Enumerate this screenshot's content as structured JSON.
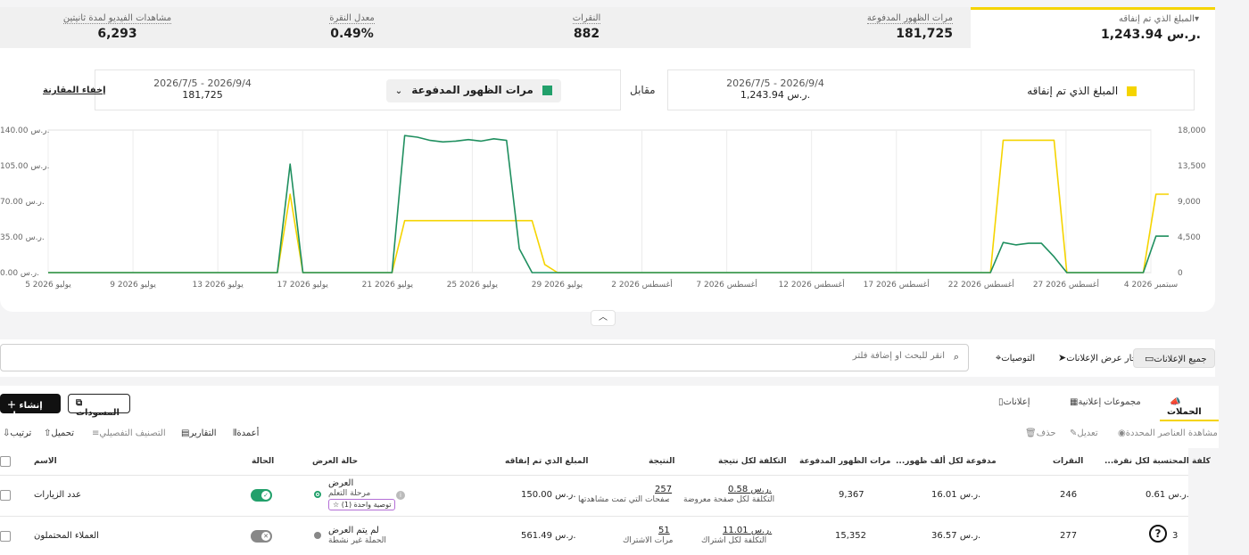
{
  "metrics": [
    {
      "label": "المبلغ الذي تم إنفاقه",
      "value": "1,243.94 ر.س."
    },
    {
      "label": "مرات الظهور المدفوعة",
      "value": "181,725"
    },
    {
      "label": "النقرات",
      "value": "882"
    },
    {
      "label": "معدل النقرة",
      "value": "0.49%"
    },
    {
      "label": "مشاهدات الفيديو لمدة ثانيتين",
      "value": "6,293"
    }
  ],
  "compare": {
    "primary": {
      "metric": "المبلغ الذي تم إنفاقه",
      "range": "2026/7/5 - 2026/9/4",
      "total": "1,243.94 ر.س."
    },
    "vs_label": "مقابل",
    "secondary": {
      "metric": "مرات الظهور المدفوعة",
      "range": "2026/7/5 - 2026/9/4",
      "total": "181,725"
    },
    "hide_label": "إخفاء المقارنة"
  },
  "colors": {
    "primary_series": "#f5d400",
    "secondary_series": "#1f8f5f"
  },
  "chart_data": {
    "type": "line",
    "x_ticks": [
      "5 يوليو 2026",
      "9 يوليو 2026",
      "13 يوليو 2026",
      "17 يوليو 2026",
      "21 يوليو 2026",
      "25 يوليو 2026",
      "29 يوليو 2026",
      "2 أغسطس 2026",
      "7 أغسطس 2026",
      "12 أغسطس 2026",
      "17 أغسطس 2026",
      "22 أغسطس 2026",
      "27 أغسطس 2026",
      "4 سبتمبر 2026"
    ],
    "y_left_ticks": [
      "0.00 ر.س.",
      "35.00 ر.س.",
      "70.00 ر.س.",
      "105.00 ر.س.",
      "140.00 ر.س."
    ],
    "y_right_ticks": [
      "0",
      "4,500",
      "9,000",
      "13,500",
      "18,000"
    ],
    "y_left_range": [
      0,
      140
    ],
    "y_right_range": [
      0,
      18000
    ],
    "series": [
      {
        "values": [
          0,
          0,
          0,
          0,
          0,
          0,
          0,
          0,
          0,
          0,
          0,
          0,
          0,
          0,
          0,
          0,
          0,
          0,
          0,
          77,
          0,
          0,
          0,
          0,
          0,
          0,
          0,
          0,
          51,
          51,
          51,
          51,
          51,
          51,
          51,
          51,
          51,
          51,
          51,
          8,
          0,
          0,
          0,
          0,
          0,
          0,
          0,
          0,
          0,
          0,
          0,
          0,
          0,
          0,
          0,
          0,
          0,
          0,
          0,
          0,
          0,
          0,
          0,
          0,
          0,
          0,
          0,
          0,
          0,
          0,
          0,
          0,
          0,
          0,
          0,
          130,
          130,
          130,
          130,
          130,
          0,
          0,
          0,
          0,
          0,
          0,
          0,
          77,
          77
        ]
      },
      {
        "values": [
          0,
          0,
          0,
          0,
          0,
          0,
          0,
          0,
          0,
          0,
          0,
          0,
          0,
          0,
          0,
          0,
          0,
          0,
          0,
          13700,
          0,
          0,
          0,
          0,
          0,
          0,
          0,
          0,
          17300,
          17100,
          16700,
          16500,
          16600,
          16800,
          16600,
          16900,
          16700,
          3000,
          0,
          0,
          0,
          0,
          0,
          0,
          0,
          0,
          0,
          0,
          0,
          0,
          0,
          0,
          0,
          0,
          0,
          0,
          0,
          0,
          0,
          0,
          0,
          0,
          0,
          0,
          0,
          0,
          0,
          0,
          0,
          0,
          0,
          0,
          0,
          0,
          0,
          3800,
          3500,
          3700,
          3700,
          2000,
          0,
          0,
          0,
          0,
          0,
          0,
          0,
          4600,
          4600
        ]
      }
    ]
  },
  "search": {
    "placeholder": "انقر للبحث أو إضافة فلتر"
  },
  "nav": {
    "all_ads": "جميع الإعلانات",
    "running": "جار عرض الإعلانات",
    "recommendations": "التوصيات"
  },
  "tabs": {
    "campaigns": "الحملات",
    "adgroups": "مجموعات إعلانية",
    "ads": "إعلانات"
  },
  "buttons": {
    "create": "إنشاء حملة",
    "drafts": "المسودات"
  },
  "toolbar": {
    "view_selected": "مشاهدة العناصر المحددة",
    "edit": "تعديل",
    "delete": "حذف",
    "columns": "أعمدة",
    "reports": "التقارير",
    "breakdown": "التصنيف التفصيلي",
    "download": "تحميل",
    "sort": "ترتيب"
  },
  "table": {
    "headers": {
      "name": "الاسم",
      "status": "الحالة",
      "delivery": "حالة العرض",
      "spend": "المبلغ الذي تم إنفاقه",
      "result": "النتيجة",
      "cost_per_result": "التكلفة لكل نتيجة",
      "impressions": "مرات الظهور المدفوعة",
      "cpm": "...مدفوعة لكل ألف ظهور",
      "clicks": "النقرات",
      "cpc": "...كلفة المحتسبة لكل نقرة"
    },
    "rows": [
      {
        "name": "عدد الزيارات",
        "delivery": "العرض",
        "delivery_sub": "مرحلة التعلم",
        "badge": "توصية واحدة (1)",
        "spend": "150.00 ر.س.",
        "result": "257",
        "result_sub": "الصفحات التي تمت مشاهدتها",
        "cpr": "0.58 ر.س.",
        "cpr_sub": "التكلفة لكل صفحة معروضة",
        "impressions": "9,367",
        "cpm": "16.01 ر.س.",
        "clicks": "246",
        "cpc": "0.61 ر.س."
      },
      {
        "name": "العملاء المحتملون",
        "delivery": "لم يتم العرض",
        "delivery_sub": "الحملة غير نشطة",
        "spend": "561.49 ر.س.",
        "result": "51",
        "result_sub": "مرات الاشتراك",
        "cpr": "11.01 ر.س.",
        "cpr_sub": "التكلفة لكل اشتراك",
        "impressions": "15,352",
        "cpm": "36.57 ر.س.",
        "clicks": "277",
        "cpc": "3"
      }
    ]
  }
}
